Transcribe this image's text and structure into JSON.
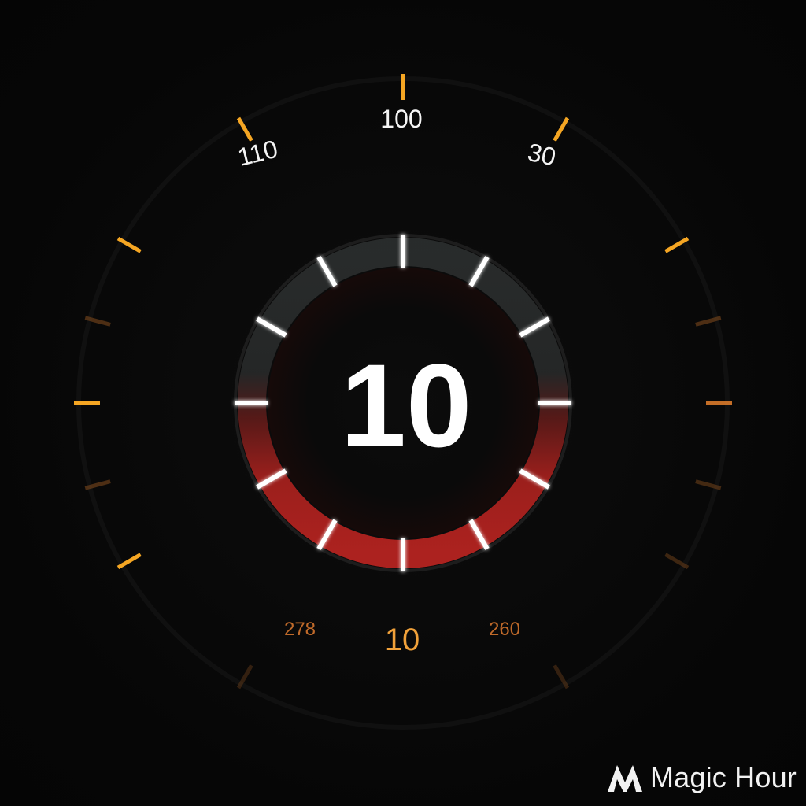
{
  "gauge": {
    "center_value": "10",
    "outer_labels": {
      "top": "100",
      "top_left": "110",
      "top_right": "30",
      "bottom_center": "10",
      "bottom_left": "278",
      "bottom_right": "260"
    }
  },
  "colors": {
    "background": "#070707",
    "accent_orange": "#f5a623",
    "dim_orange": "#6b3f1a",
    "danger_red": "#b3201f",
    "tick_white": "#ffffff",
    "label_orange": "#d97a2b"
  },
  "watermark": {
    "text": "Magic Hour",
    "icon": "magic-hour-logo-icon"
  }
}
